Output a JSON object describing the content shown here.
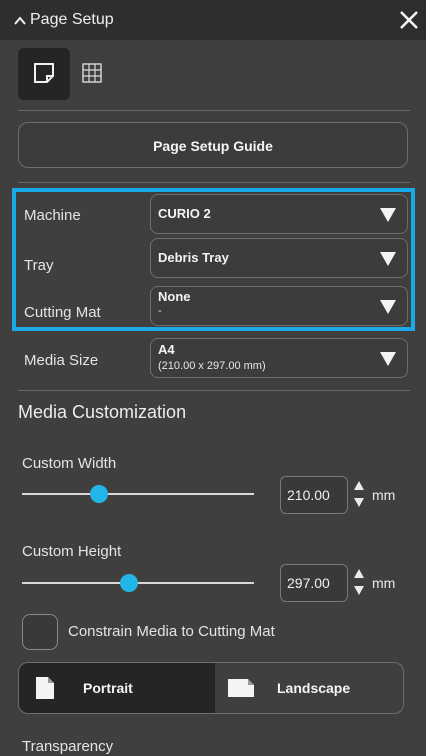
{
  "header": {
    "title": "Page Setup"
  },
  "view_tabs": [
    {
      "name": "page-icon",
      "active": true
    },
    {
      "name": "grid-icon",
      "active": false
    }
  ],
  "guide_button": {
    "label": "Page Setup Guide"
  },
  "machine": {
    "label": "Machine",
    "value": "CURIO 2"
  },
  "tray": {
    "label": "Tray",
    "value": "Debris Tray"
  },
  "cutting_mat": {
    "label": "Cutting Mat",
    "value": "None",
    "sub": "-"
  },
  "media_size": {
    "label": "Media Size",
    "value": "A4",
    "sub": "(210.00 x 297.00 mm)"
  },
  "media_customization": {
    "title": "Media Customization",
    "width": {
      "label": "Custom Width",
      "value": "210.00",
      "unit": "mm",
      "slider_fraction": 0.33
    },
    "height": {
      "label": "Custom Height",
      "value": "297.00",
      "unit": "mm",
      "slider_fraction": 0.46
    }
  },
  "constrain": {
    "label": "Constrain Media to Cutting Mat",
    "checked": false
  },
  "orientation": {
    "portrait": "Portrait",
    "landscape": "Landscape",
    "selected": "Portrait"
  },
  "transparency": {
    "label": "Transparency"
  },
  "colors": {
    "accent": "#1aa8e6",
    "slider_thumb": "#22b6e8",
    "panel_bg": "#403f3e",
    "title_bg": "#2f2e2d"
  }
}
